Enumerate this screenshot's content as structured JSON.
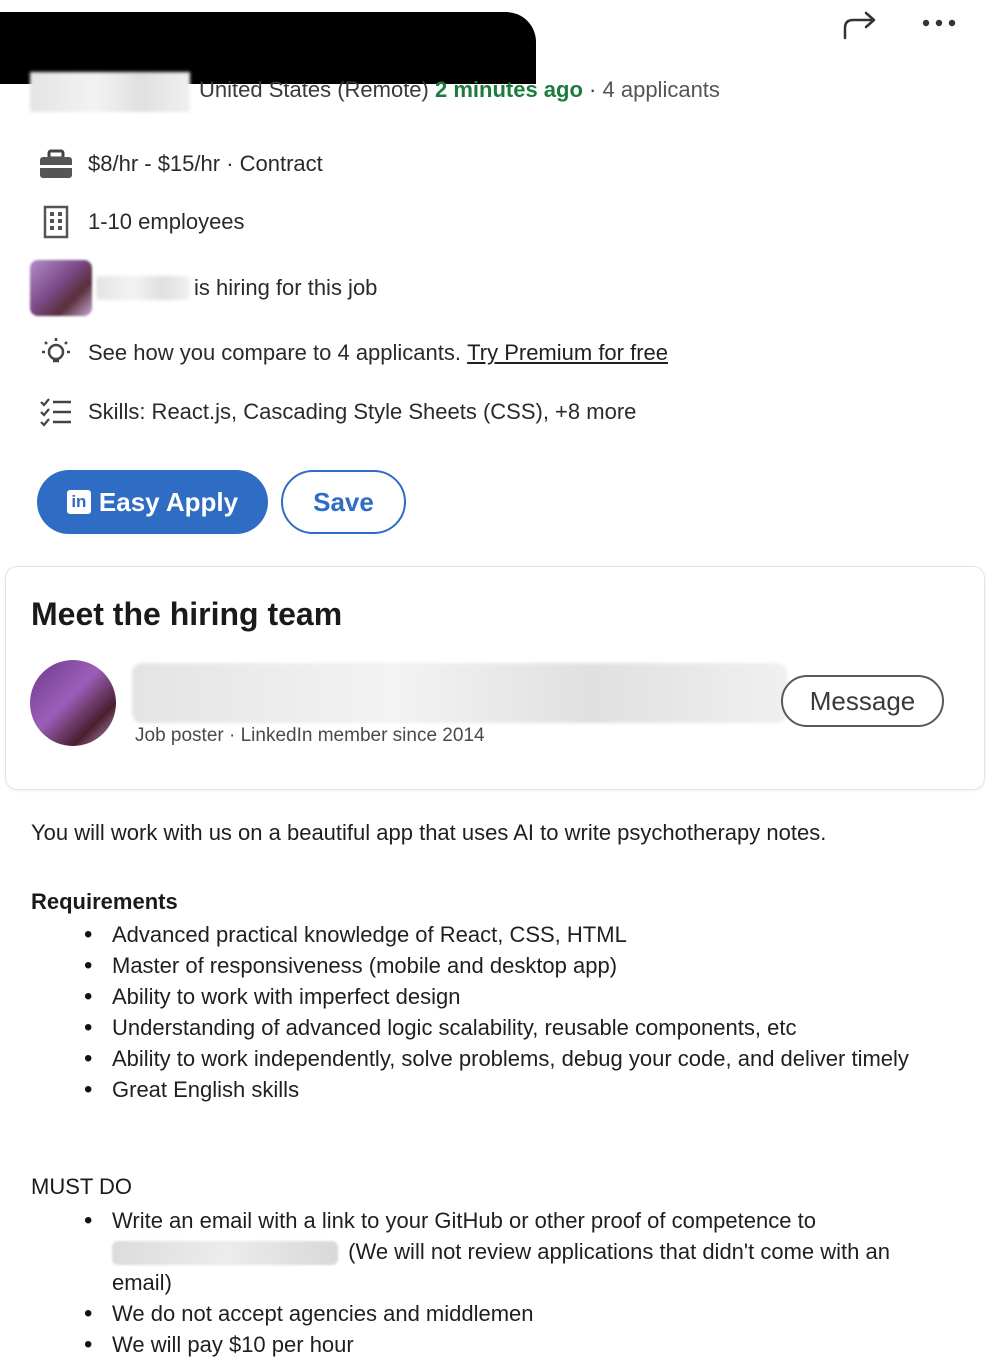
{
  "header": {
    "location": "United States (Remote)",
    "posted": "2 minutes ago",
    "separator": "·",
    "applicants": "4 applicants"
  },
  "job_insights": {
    "pay_type": "$8/hr - $15/hr · Contract",
    "company_size": "1-10 employees",
    "hiring_text": "is hiring for this job",
    "compare_text": "See how you compare to 4 applicants.",
    "premium_link": "Try Premium for free",
    "skills": "Skills: React.js, Cascading Style Sheets (CSS), +8 more"
  },
  "actions": {
    "easy_apply": "Easy Apply",
    "linkedin_logo": "in",
    "save": "Save"
  },
  "hiring_team": {
    "title": "Meet the hiring team",
    "poster_sub": "Job poster · LinkedIn member since 2014",
    "message_button": "Message"
  },
  "description": {
    "intro": "You will work with us on a beautiful app that uses AI to write psychotherapy notes.",
    "requirements_heading": "Requirements",
    "requirements": [
      "Advanced practical knowledge of React, CSS, HTML",
      "Master of responsiveness (mobile and desktop app)",
      "Ability to work with imperfect design",
      "Understanding of advanced logic scalability, reusable components, etc",
      "Ability to work independently, solve problems, debug your code, and deliver timely",
      "Great English skills"
    ],
    "must_do_heading": "MUST DO",
    "must_do_first": "Write an email with a link to your GitHub or other proof of competence to",
    "must_do_first_cont": "(We will not review applications that didn't come with an email)",
    "must_do": [
      "We do not accept agencies and middlemen",
      "We will pay $10 per hour"
    ]
  },
  "colors": {
    "accent": "#2f6cc4",
    "posted_green": "#1f7a3d"
  },
  "icons": {
    "share": "share-arrow-icon",
    "more": "more-icon",
    "briefcase": "briefcase-icon",
    "building": "building-icon",
    "lightbulb": "lightbulb-icon",
    "checklist": "checklist-icon"
  }
}
